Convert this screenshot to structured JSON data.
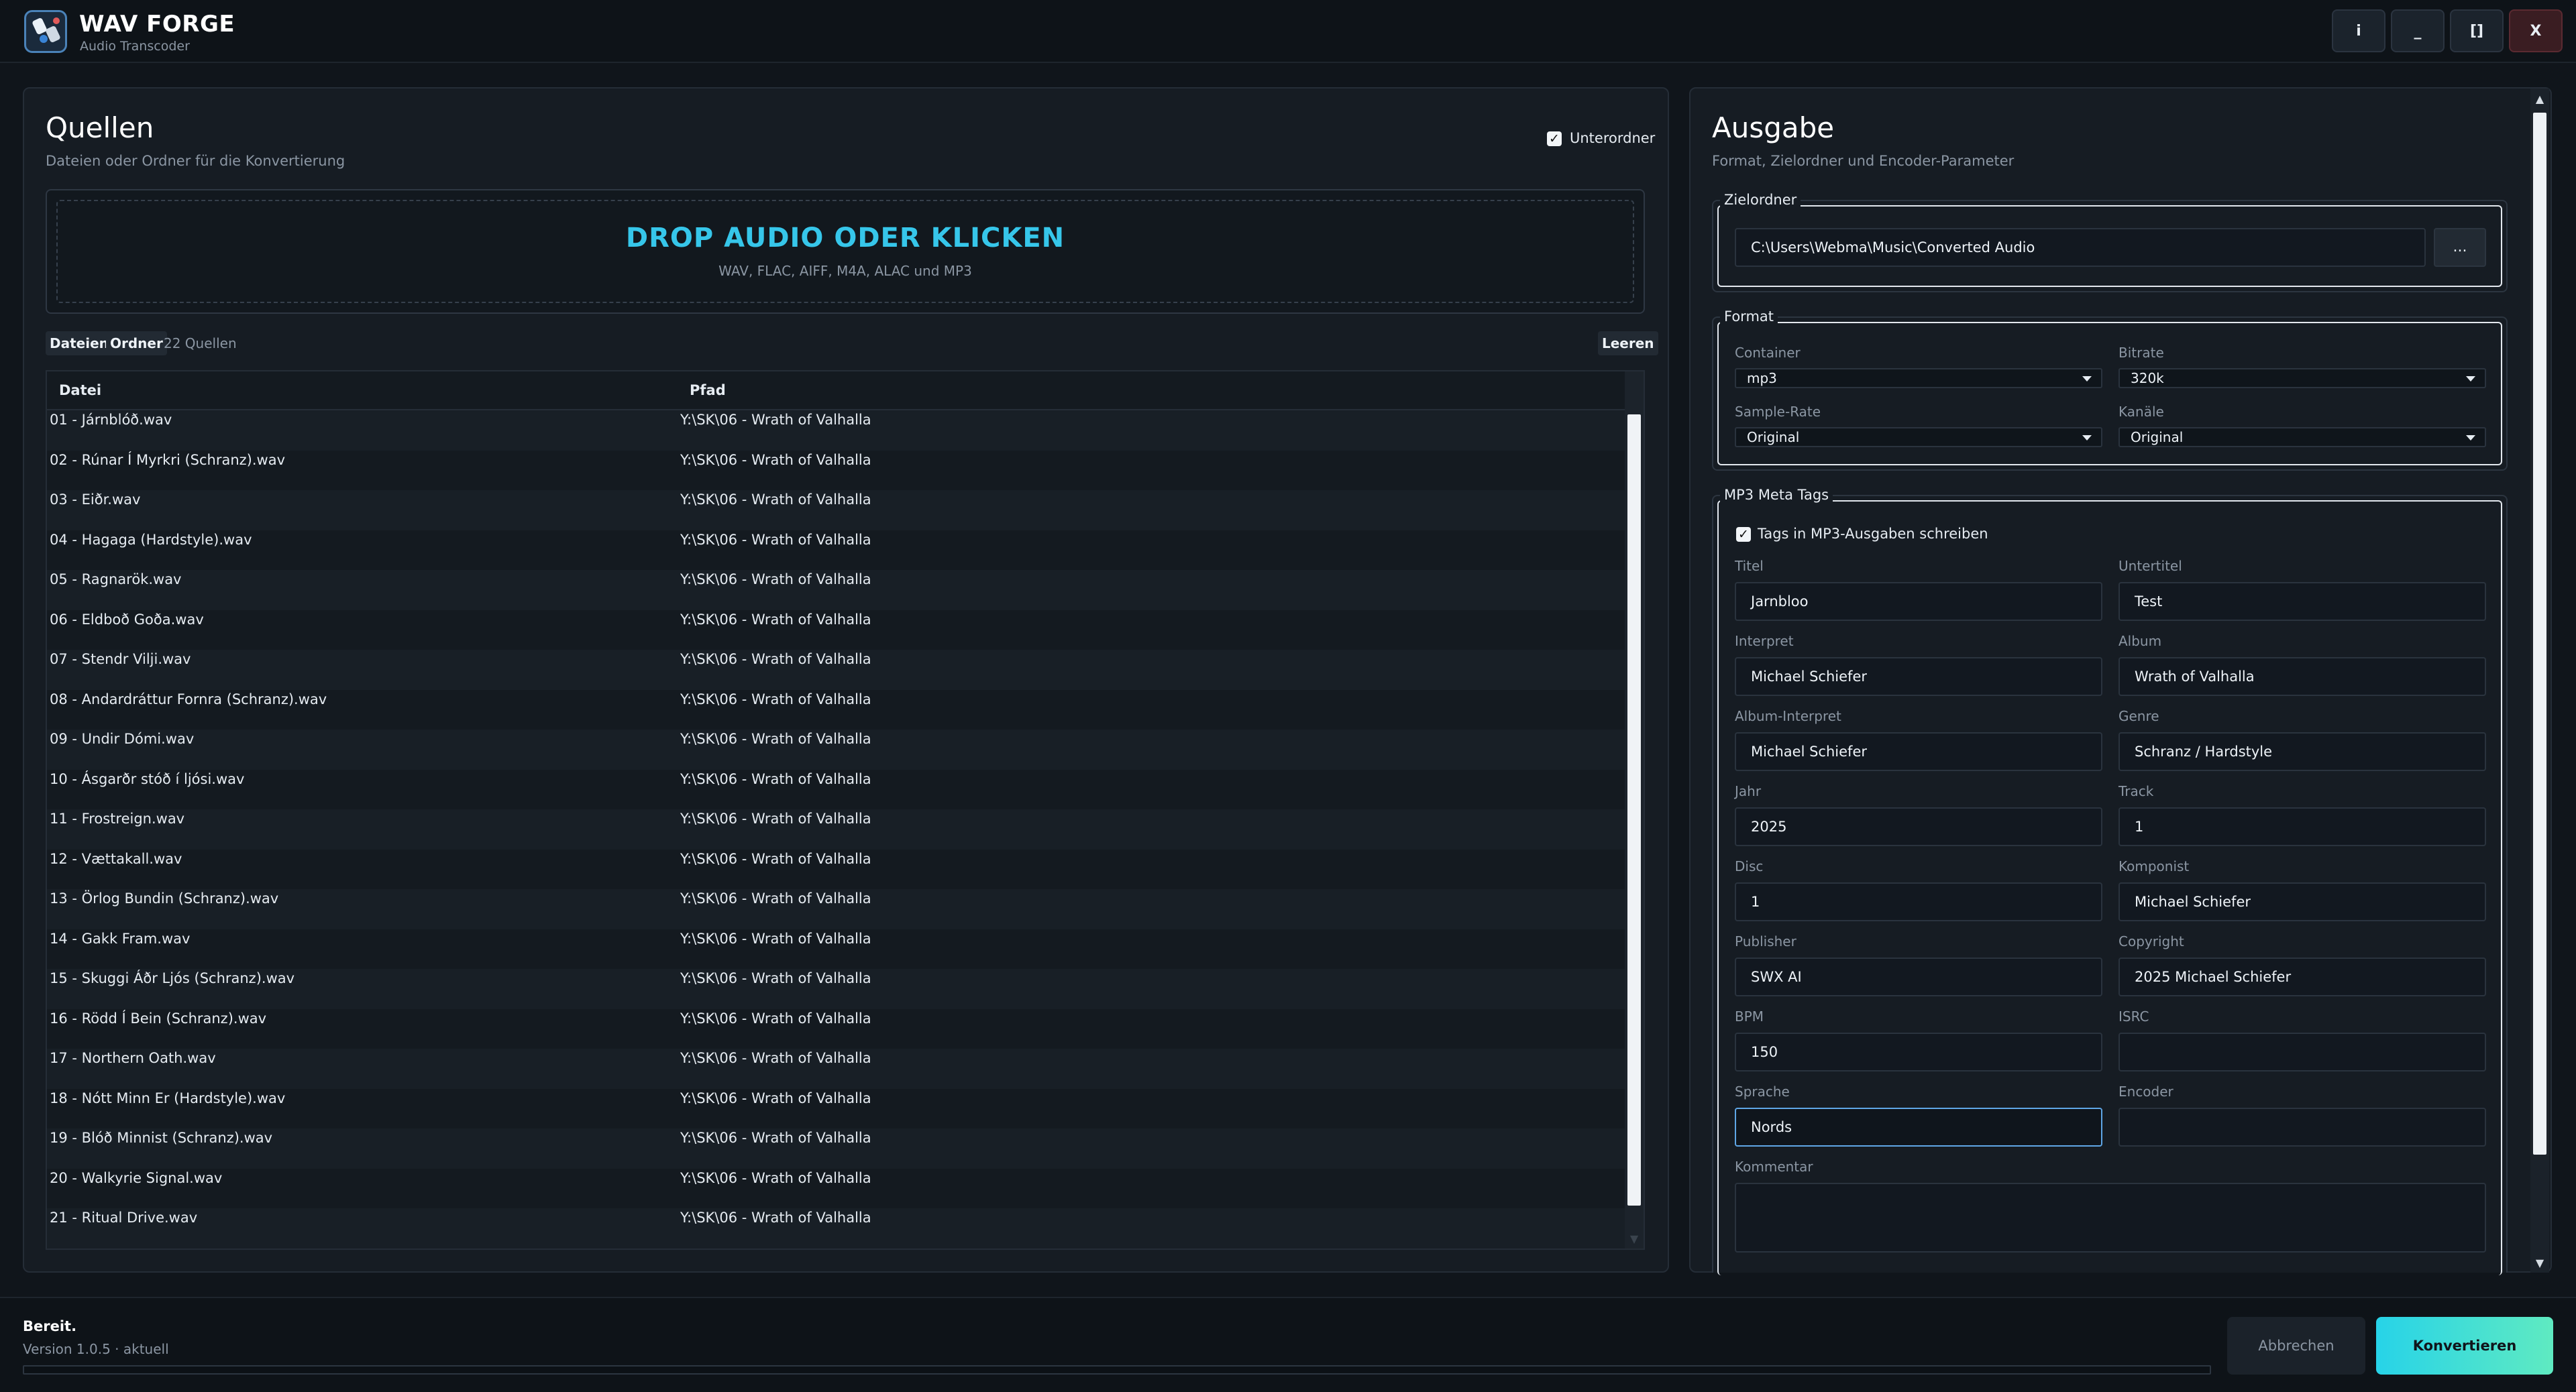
{
  "app": {
    "title": "WAV FORGE",
    "subtitle": "Audio Transcoder"
  },
  "window_buttons": {
    "info": "i",
    "minimize": "_",
    "maximize": "[]",
    "close": "X"
  },
  "sources": {
    "title": "Quellen",
    "subtitle": "Dateien oder Ordner für die Konvertierung",
    "subfolder_label": "Unterordner",
    "subfolder_checked": true,
    "dropzone_title": "DROP AUDIO ODER KLICKEN",
    "dropzone_sub": "WAV, FLAC, AIFF, M4A, ALAC und MP3",
    "files_button": "Dateien",
    "folder_button": "Ordner",
    "count_text": "22 Quellen",
    "clear_button": "Leeren",
    "columns": [
      "Datei",
      "Pfad"
    ],
    "rows": [
      {
        "file": "01 - Járnblóð.wav",
        "path": "Y:\\SK\\06 - Wrath of Valhalla"
      },
      {
        "file": "02 - Rúnar Í Myrkri (Schranz).wav",
        "path": "Y:\\SK\\06 - Wrath of Valhalla"
      },
      {
        "file": "03 - Eiðr.wav",
        "path": "Y:\\SK\\06 - Wrath of Valhalla"
      },
      {
        "file": "04 - Hagaga (Hardstyle).wav",
        "path": "Y:\\SK\\06 - Wrath of Valhalla"
      },
      {
        "file": "05 - Ragnarök.wav",
        "path": "Y:\\SK\\06 - Wrath of Valhalla"
      },
      {
        "file": "06 - Eldboð Goða.wav",
        "path": "Y:\\SK\\06 - Wrath of Valhalla"
      },
      {
        "file": "07 - Stendr Vilji.wav",
        "path": "Y:\\SK\\06 - Wrath of Valhalla"
      },
      {
        "file": "08 - Andardráttur Fornra (Schranz).wav",
        "path": "Y:\\SK\\06 - Wrath of Valhalla"
      },
      {
        "file": "09 - Undir Dómi.wav",
        "path": "Y:\\SK\\06 - Wrath of Valhalla"
      },
      {
        "file": "10 - Ásgarðr stóð í ljósi.wav",
        "path": "Y:\\SK\\06 - Wrath of Valhalla"
      },
      {
        "file": "11 - Frostreign.wav",
        "path": "Y:\\SK\\06 - Wrath of Valhalla"
      },
      {
        "file": "12 - Vættakall.wav",
        "path": "Y:\\SK\\06 - Wrath of Valhalla"
      },
      {
        "file": "13 - Örlog Bundin (Schranz).wav",
        "path": "Y:\\SK\\06 - Wrath of Valhalla"
      },
      {
        "file": "14 - Gakk Fram.wav",
        "path": "Y:\\SK\\06 - Wrath of Valhalla"
      },
      {
        "file": "15 - Skuggi Áðr Ljós (Schranz).wav",
        "path": "Y:\\SK\\06 - Wrath of Valhalla"
      },
      {
        "file": "16 - Rödd Í Bein (Schranz).wav",
        "path": "Y:\\SK\\06 - Wrath of Valhalla"
      },
      {
        "file": "17 - Northern Oath.wav",
        "path": "Y:\\SK\\06 - Wrath of Valhalla"
      },
      {
        "file": "18 - Nótt Minn Er (Hardstyle).wav",
        "path": "Y:\\SK\\06 - Wrath of Valhalla"
      },
      {
        "file": "19 - Blóð Minnist (Schranz).wav",
        "path": "Y:\\SK\\06 - Wrath of Valhalla"
      },
      {
        "file": "20 - Walkyrie Signal.wav",
        "path": "Y:\\SK\\06 - Wrath of Valhalla"
      },
      {
        "file": "21 - Ritual Drive.wav",
        "path": "Y:\\SK\\06 - Wrath of Valhalla"
      }
    ]
  },
  "output": {
    "title": "Ausgabe",
    "subtitle": "Format, Zielordner und Encoder-Parameter",
    "target": {
      "legend": "Zielordner",
      "path": "C:\\Users\\Webma\\Music\\Converted Audio",
      "browse": "..."
    },
    "format": {
      "legend": "Format",
      "container_label": "Container",
      "container_value": "mp3",
      "bitrate_label": "Bitrate",
      "bitrate_value": "320k",
      "samplerate_label": "Sample-Rate",
      "samplerate_value": "Original",
      "channels_label": "Kanäle",
      "channels_value": "Original"
    },
    "meta": {
      "legend": "MP3 Meta Tags",
      "write_tags_label": "Tags in MP3-Ausgaben schreiben",
      "write_tags_checked": true,
      "title_label": "Titel",
      "title_value": "Jarnbloo",
      "subtitle_label": "Untertitel",
      "subtitle_value": "Test",
      "artist_label": "Interpret",
      "artist_value": "Michael Schiefer",
      "album_label": "Album",
      "album_value": "Wrath of Valhalla",
      "album_artist_label": "Album-Interpret",
      "album_artist_value": "Michael Schiefer",
      "genre_label": "Genre",
      "genre_value": "Schranz / Hardstyle",
      "year_label": "Jahr",
      "year_value": "2025",
      "track_label": "Track",
      "track_value": "1",
      "disc_label": "Disc",
      "disc_value": "1",
      "composer_label": "Komponist",
      "composer_value": "Michael Schiefer",
      "publisher_label": "Publisher",
      "publisher_value": "SWX AI",
      "copyright_label": "Copyright",
      "copyright_value": "2025 Michael Schiefer",
      "bpm_label": "BPM",
      "bpm_value": "150",
      "isrc_label": "ISRC",
      "isrc_value": "",
      "language_label": "Sprache",
      "language_value": "Nords",
      "encoder_label": "Encoder",
      "encoder_value": "",
      "comment_label": "Kommentar",
      "comment_value": ""
    }
  },
  "footer": {
    "status": "Bereit.",
    "version": "Version 1.0.5 · aktuell",
    "progress": 0,
    "cancel": "Abbrechen",
    "convert": "Konvertieren"
  },
  "colors": {
    "accent": "#36c6ea",
    "accent2": "#5feac1",
    "background": "#10151b",
    "panel": "#161c23"
  }
}
